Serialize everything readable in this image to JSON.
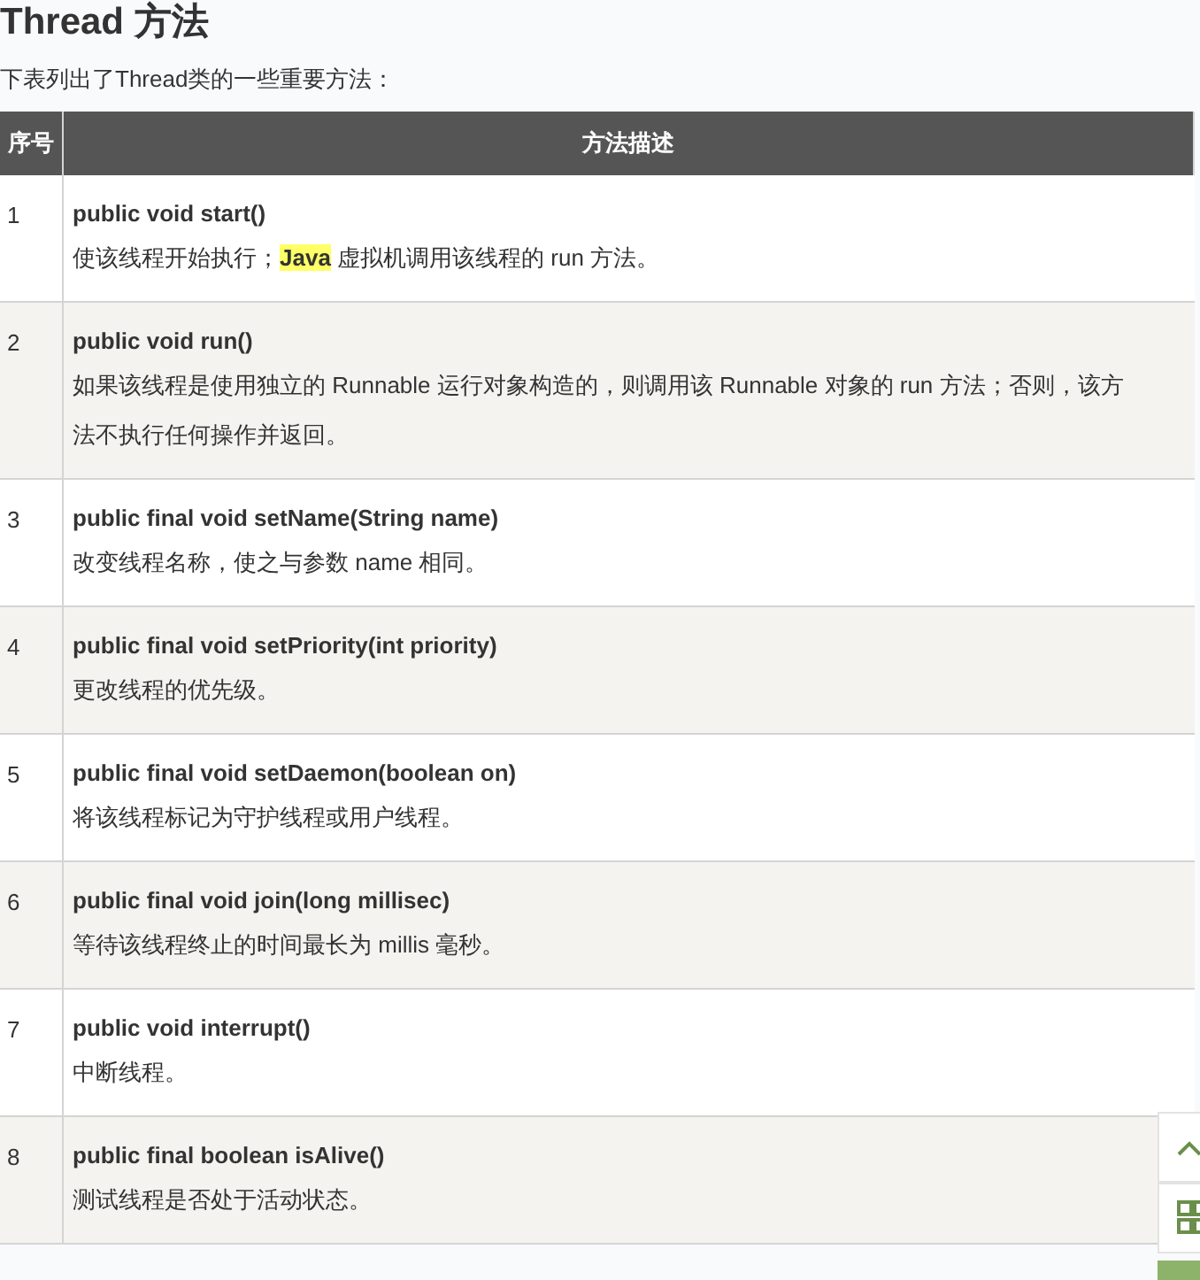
{
  "title": "Thread 方法",
  "intro": "下表列出了Thread类的一些重要方法：",
  "table": {
    "columns": [
      "序号",
      "方法描述"
    ],
    "rows": [
      {
        "number": "1",
        "method": "public void start()",
        "description": "使该线程开始执行；**Java** 虚拟机调用该线程的 run 方法。"
      },
      {
        "number": "2",
        "method": "public void run()",
        "description": "如果该线程是使用独立的 Runnable 运行对象构造的，则调用该 Runnable 对象的 run 方法；否则，该方法不执行任何操作并返回。"
      },
      {
        "number": "3",
        "method": "public final void setName(String name)",
        "description": "改变线程名称，使之与参数 name 相同。"
      },
      {
        "number": "4",
        "method": "public final void setPriority(int priority)",
        "description": " 更改线程的优先级。"
      },
      {
        "number": "5",
        "method": "public final void setDaemon(boolean on)",
        "description": "将该线程标记为守护线程或用户线程。"
      },
      {
        "number": "6",
        "method": "public final void join(long millisec)",
        "description": "等待该线程终止的时间最长为 millis 毫秒。"
      },
      {
        "number": "7",
        "method": "public void interrupt()",
        "description": "中断线程。"
      },
      {
        "number": "8",
        "method": "public final boolean isAlive()",
        "description": "测试线程是否处于活动状态。"
      }
    ]
  }
}
